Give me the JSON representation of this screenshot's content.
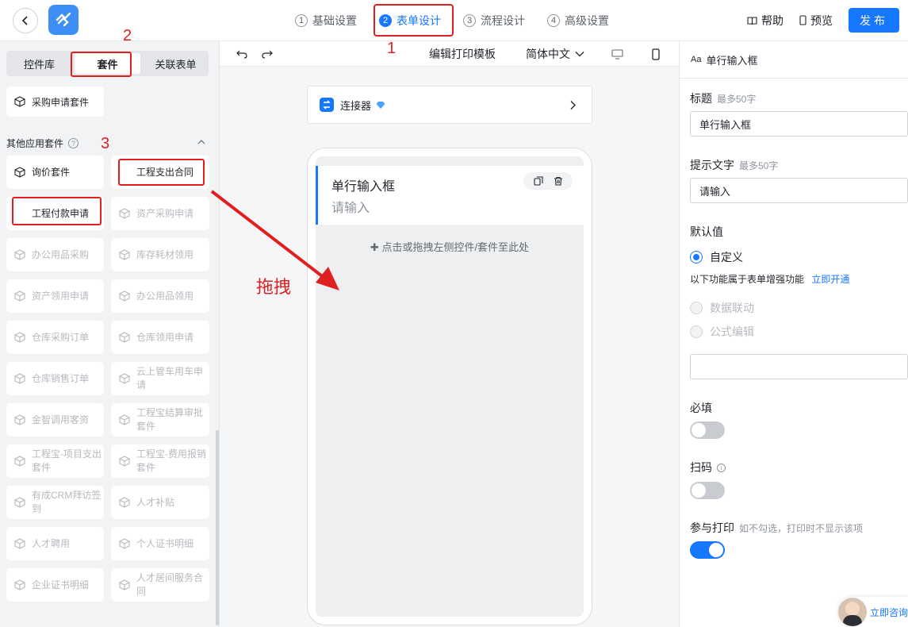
{
  "header": {
    "steps": [
      {
        "num": "1",
        "label": "基础设置"
      },
      {
        "num": "2",
        "label": "表单设计"
      },
      {
        "num": "3",
        "label": "流程设计"
      },
      {
        "num": "4",
        "label": "高级设置"
      }
    ],
    "help_label": "帮助",
    "preview_label": "预览",
    "publish_label": "发布"
  },
  "left": {
    "tabs": [
      "控件库",
      "套件",
      "关联表单"
    ],
    "top_kit": "采购申请套件",
    "section_title": "其他应用套件",
    "section_help": "?",
    "kits": [
      "询价套件",
      "工程支出合同",
      "工程付款申请",
      "资产采购申请",
      "办公用品采购",
      "库存耗材领用",
      "资产领用申请",
      "办公用品领用",
      "仓库采购订单",
      "仓库领用申请",
      "仓库销售订单",
      "云上管车用车申请",
      "金智调用客资",
      "工程宝结算审批套件",
      "工程宝-项目支出套件",
      "工程宝-费用报销套件",
      "有成CRM拜访签到",
      "人才补贴",
      "人才聘用",
      "个人证书明细",
      "企业证书明细",
      "人才居间服务合同"
    ]
  },
  "annotations": {
    "n1": "1",
    "n2": "2",
    "n3": "3",
    "drag": "拖拽"
  },
  "canvas": {
    "print_template": "编辑打印模板",
    "language": "简体中文",
    "connector": "连接器",
    "field_title": "单行输入框",
    "field_placeholder": "请输入",
    "drop_hint": "点击或拖拽左侧控件/套件至此处"
  },
  "right": {
    "head": "单行输入框",
    "title_label": "标题",
    "title_hint": "最多50字",
    "title_value": "单行输入框",
    "ph_label": "提示文字",
    "ph_hint": "最多50字",
    "ph_value": "请输入",
    "default_label": "默认值",
    "custom_option": "自定义",
    "enhance_note": "以下功能属于表单增强功能",
    "enhance_link": "立即开通",
    "data_link": "数据联动",
    "formula": "公式编辑",
    "required_label": "必填",
    "scan_label": "扫码",
    "print_label": "参与打印",
    "print_hint": "如不勾选，打印时不显示该项",
    "consult": "立即咨询"
  },
  "colors": {
    "accent": "#1677ff",
    "annotation": "#e02020"
  }
}
